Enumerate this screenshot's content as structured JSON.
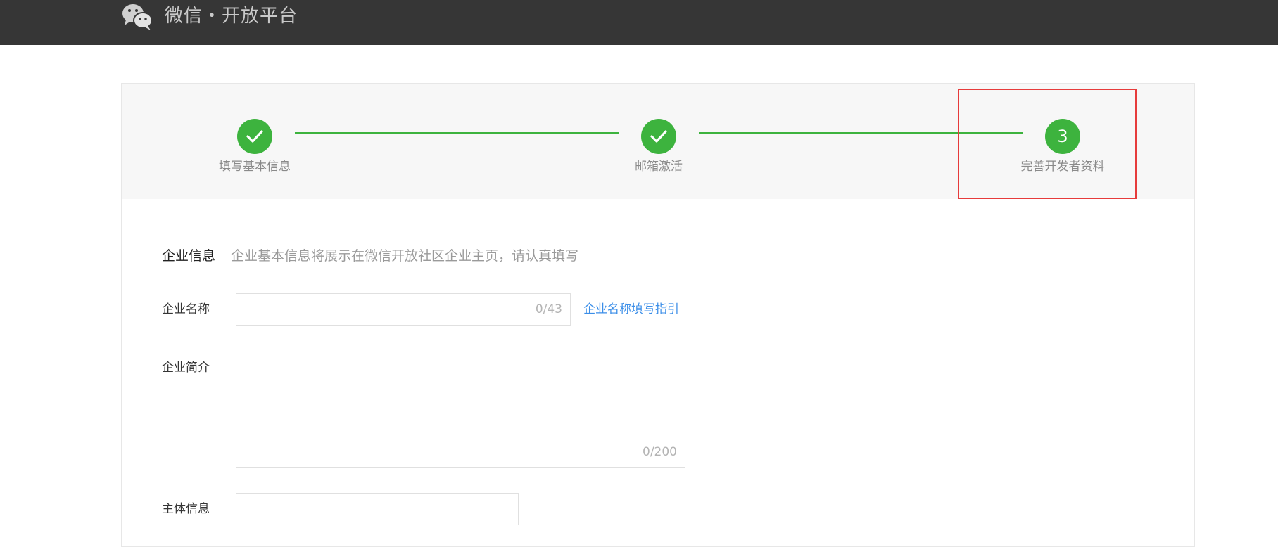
{
  "header": {
    "brand": "微信・开放平台",
    "logo_icon": "wechat-logo-icon"
  },
  "steps": [
    {
      "label": "填写基本信息",
      "state": "done",
      "icon": "check-icon"
    },
    {
      "label": "邮箱激活",
      "state": "done",
      "icon": "check-icon"
    },
    {
      "label": "完善开发者资料",
      "state": "current",
      "number": "3"
    }
  ],
  "section": {
    "title": "企业信息",
    "description": "企业基本信息将展示在微信开放社区企业主页，请认真填写"
  },
  "form": {
    "company_name": {
      "label": "企业名称",
      "value": "",
      "counter": "0/43",
      "guide_link": "企业名称填写指引"
    },
    "company_intro": {
      "label": "企业简介",
      "value": "",
      "counter": "0/200"
    },
    "entity_info": {
      "label": "主体信息",
      "value": ""
    }
  },
  "colors": {
    "accent_green": "#3db33e",
    "link_blue": "#3b8ee8",
    "highlight_red": "#e63b3b",
    "topbar": "#363636"
  }
}
